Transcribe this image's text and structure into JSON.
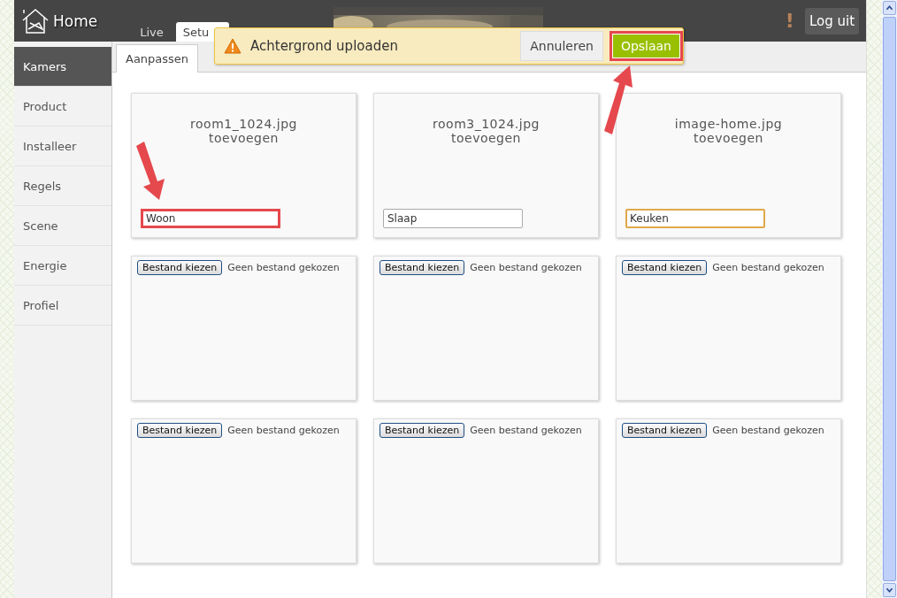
{
  "header": {
    "logo": "Home",
    "tabs": [
      {
        "label": "Live",
        "selected": false
      },
      {
        "label": "Setu",
        "selected": true
      }
    ],
    "alert": "!",
    "logout": "Log uit"
  },
  "notification": {
    "message": "Achtergrond uploaden",
    "buttons": [
      {
        "label": "Annuleren",
        "kind": "secondary",
        "highlighted": false
      },
      {
        "label": "Opslaan",
        "kind": "primary",
        "highlighted": true
      }
    ]
  },
  "sidebar": {
    "items": [
      {
        "label": "Kamers",
        "selected": true
      },
      {
        "label": "Product",
        "selected": false
      },
      {
        "label": "Installeer",
        "selected": false
      },
      {
        "label": "Regels",
        "selected": false
      },
      {
        "label": "Scene",
        "selected": false
      },
      {
        "label": "Energie",
        "selected": false
      },
      {
        "label": "Profiel",
        "selected": false
      }
    ]
  },
  "subtabs": [
    {
      "label": "Aanpassen",
      "selected": true
    }
  ],
  "rooms": [
    {
      "file": "room1_1024.jpg",
      "action": "toevoegen",
      "name": "Woon",
      "highlighted": true,
      "focused": false
    },
    {
      "file": "room3_1024.jpg",
      "action": "toevoegen",
      "name": "Slaap",
      "highlighted": false,
      "focused": false
    },
    {
      "file": "image-home.jpg",
      "action": "toevoegen",
      "name": "Keuken",
      "highlighted": false,
      "focused": true
    }
  ],
  "uploads": [
    {
      "button": "Bestand kiezen",
      "status": "Geen bestand gekozen"
    },
    {
      "button": "Bestand kiezen",
      "status": "Geen bestand gekozen"
    },
    {
      "button": "Bestand kiezen",
      "status": "Geen bestand gekozen"
    },
    {
      "button": "Bestand kiezen",
      "status": "Geen bestand gekozen"
    },
    {
      "button": "Bestand kiezen",
      "status": "Geen bestand gekozen"
    },
    {
      "button": "Bestand kiezen",
      "status": "Geen bestand gekozen"
    }
  ]
}
